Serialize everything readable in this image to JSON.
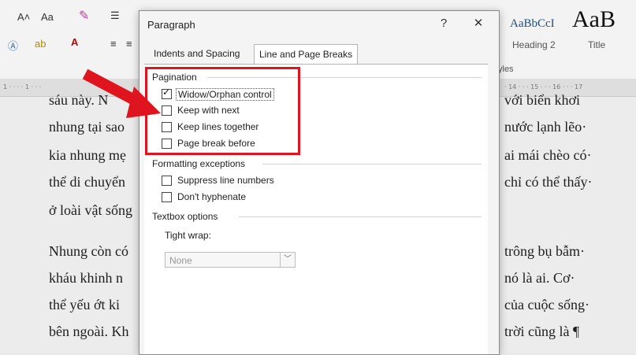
{
  "ribbon": {
    "grow_font": "A˄",
    "case_button": "Aa",
    "indent_icon": "☰",
    "styles": [
      {
        "preview": "AaBbCcI",
        "name": "Heading 2"
      },
      {
        "preview": "AaB",
        "name": "Title"
      }
    ],
    "styles_group": "yles"
  },
  "ruler": {
    "left": "1 · · · · 1 · · ·",
    "right": "· 14 · · · 15 · · · 16 · · · 17"
  },
  "document": {
    "left_lines": [
      "sáu này. N",
      "nhung tại sao",
      "kia nhung mẹ",
      "thể di chuyển",
      "ở loài vật sống",
      "Nhung còn có",
      "kháu khinh n",
      "thể yếu ớt ki",
      "bên ngoài. Kh"
    ],
    "right_lines": [
      "với biển khơi",
      "nước lạnh lẽo·",
      "ai mái chèo có·",
      "chỉ có thể thấy·",
      "trông bụ bẫm·",
      "nó là ai. Cơ·",
      "của cuộc sống·",
      "trời cũng là ¶"
    ]
  },
  "dialog": {
    "title": "Paragraph",
    "help": "?",
    "close": "✕",
    "tabs": [
      "Indents and Spacing",
      "Line and Page Breaks"
    ],
    "pagination": {
      "heading": "Pagination",
      "options": [
        {
          "label": "Widow/Orphan control",
          "checked": true
        },
        {
          "label": "Keep with next",
          "checked": false
        },
        {
          "label": "Keep lines together",
          "checked": false
        },
        {
          "label": "Page break before",
          "checked": false
        }
      ]
    },
    "formatting": {
      "heading": "Formatting exceptions",
      "options": [
        {
          "label": "Suppress line numbers",
          "checked": false
        },
        {
          "label": "Don't hyphenate",
          "checked": false
        }
      ]
    },
    "textbox": {
      "heading": "Textbox options",
      "tight_wrap_label": "Tight wrap:",
      "tight_wrap_value": "None"
    }
  },
  "annotation": {
    "highlight_color": "#e0141e"
  }
}
